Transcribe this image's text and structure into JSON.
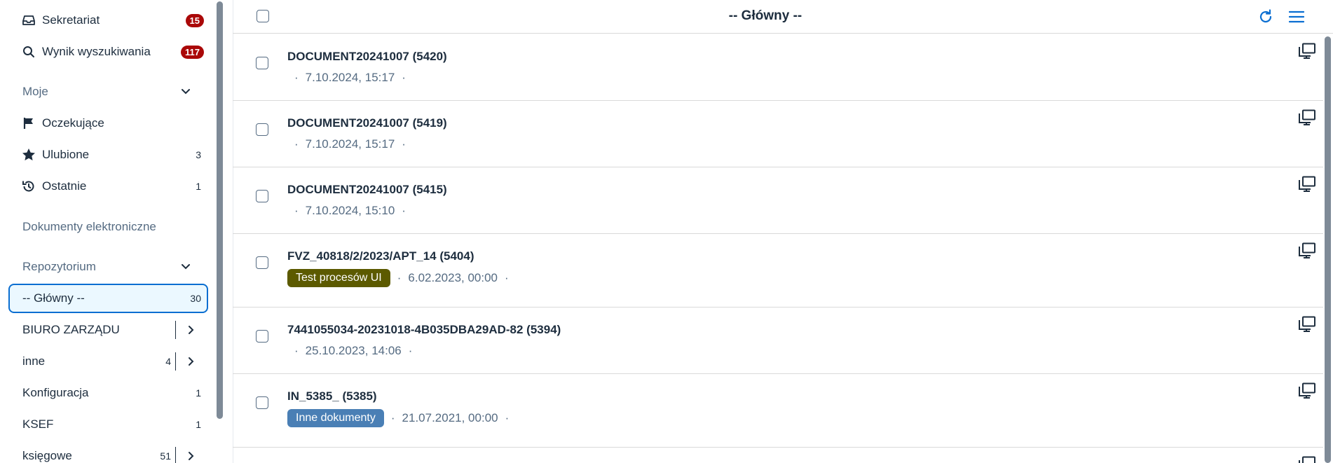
{
  "sidebar": {
    "top_items": [
      {
        "label": "Sekretariat",
        "badge": "15",
        "icon": "inbox-icon"
      },
      {
        "label": "Wynik wyszukiwania",
        "badge": "117",
        "icon": "search-icon"
      }
    ],
    "moje": {
      "header": "Moje",
      "items": [
        {
          "label": "Oczekujące",
          "count": "",
          "icon": "flag-icon"
        },
        {
          "label": "Ulubione",
          "count": "3",
          "icon": "star-icon"
        },
        {
          "label": "Ostatnie",
          "count": "1",
          "icon": "history-icon"
        }
      ]
    },
    "electronic_docs": "Dokumenty elektroniczne",
    "repo": {
      "header": "Repozytorium",
      "items": [
        {
          "label": "-- Główny --",
          "count": "30",
          "selected": true
        },
        {
          "label": "BIURO ZARZĄDU",
          "count": "",
          "expandable": true
        },
        {
          "label": "inne",
          "count": "4",
          "expandable": true
        },
        {
          "label": "Konfiguracja",
          "count": "1"
        },
        {
          "label": "KSEF",
          "count": "1"
        },
        {
          "label": "księgowe",
          "count": "51",
          "expandable": true
        }
      ]
    }
  },
  "main": {
    "title": "-- Główny --",
    "items": [
      {
        "title": "DOCUMENT20241007 (5420)",
        "tag": "",
        "date": "7.10.2024, 15:17"
      },
      {
        "title": "DOCUMENT20241007 (5419)",
        "tag": "",
        "date": "7.10.2024, 15:17"
      },
      {
        "title": "DOCUMENT20241007 (5415)",
        "tag": "",
        "date": "7.10.2024, 15:10"
      },
      {
        "title": "FVZ_40818/2/2023/APT_14 (5404)",
        "tag": "Test procesów UI",
        "tag_color": "#5c5a00",
        "date": "6.02.2023, 00:00"
      },
      {
        "title": "7441055034-20231018-4B035DBA29AD-82 (5394)",
        "tag": "",
        "date": "25.10.2023, 14:06"
      },
      {
        "title": "IN_5385_ (5385)",
        "tag": "Inne dokumenty",
        "tag_color": "#4a7fb5",
        "date": "21.07.2021, 00:00"
      }
    ]
  },
  "colors": {
    "accent": "#0a6ed1",
    "badge": "#aa0808"
  }
}
